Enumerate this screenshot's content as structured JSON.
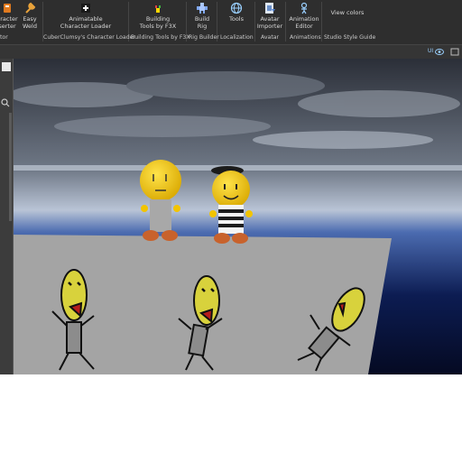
{
  "ribbon": {
    "plugins": [
      {
        "id": "character-inserter",
        "lines": [
          "aracter",
          "serter"
        ],
        "icon": "character-inserter-icon",
        "color": "#e07a1f"
      },
      {
        "id": "easy-weld",
        "lines": [
          "Easy",
          "Weld"
        ],
        "icon": "wrench-icon",
        "color": "#e8a23a"
      },
      {
        "id": "animatable-character-loader",
        "lines": [
          "Animatable",
          "Character Loader"
        ],
        "icon": "plus-icon",
        "color": "#ffffff"
      },
      {
        "id": "building-tools",
        "lines": [
          "Building",
          "Tools by F3X"
        ],
        "icon": "f3x-icon",
        "color": "#ffd700"
      },
      {
        "id": "build-rig",
        "lines": [
          "Build",
          "Rig"
        ],
        "icon": "rig-icon",
        "color": "#a9c7ff"
      },
      {
        "id": "tools",
        "lines": [
          "Tools"
        ],
        "icon": "globe-icon",
        "color": "#9ad0ff"
      },
      {
        "id": "avatar-importer",
        "lines": [
          "Avatar",
          "Importer"
        ],
        "icon": "avatar-importer-icon",
        "color": "#9ad0ff"
      },
      {
        "id": "animation-editor",
        "lines": [
          "Animation",
          "Editor"
        ],
        "icon": "animation-icon",
        "color": "#9ad0ff"
      },
      {
        "id": "view-colors",
        "lines": [
          "View colors"
        ],
        "icon": "",
        "color": ""
      }
    ],
    "groups": [
      "tor",
      "CuberClumsy's Character Loader",
      "Building Tools by F3X",
      "Rig Builder",
      "Localization",
      "Avatar",
      "Animations",
      "Studio Style Guide"
    ]
  },
  "toolbar2": {
    "ui_label": "UI"
  }
}
